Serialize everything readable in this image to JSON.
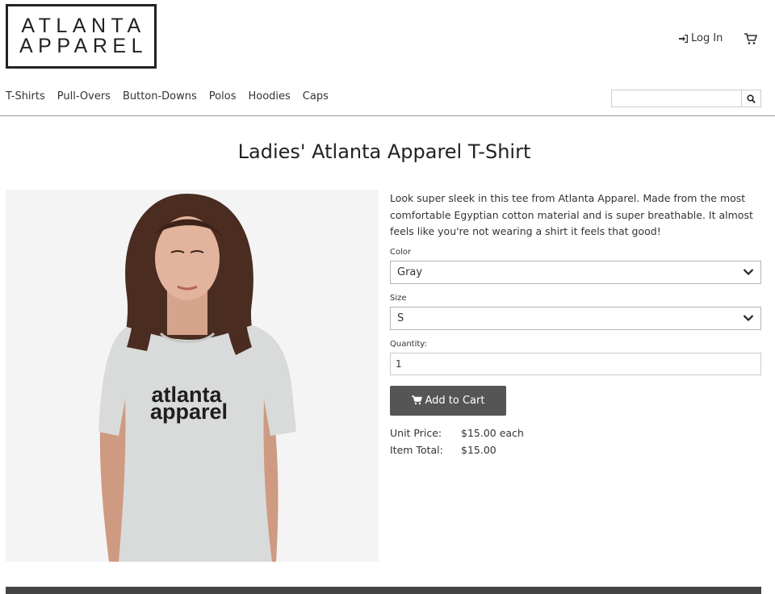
{
  "brand": {
    "line1": "ATLANTA",
    "line2": "APPAREL"
  },
  "header": {
    "login_label": "Log In",
    "cart_icon": "shopping-cart-icon"
  },
  "nav": {
    "items": [
      "T-Shirts",
      "Pull-Overs",
      "Button-Downs",
      "Polos",
      "Hoodies",
      "Caps"
    ]
  },
  "search": {
    "value": "",
    "placeholder": "",
    "icon": "search-icon"
  },
  "product": {
    "title": "Ladies' Atlanta Apparel T-Shirt",
    "shirt_print_line1": "atlanta",
    "shirt_print_line2": "apparel",
    "description": "Look super sleek in this tee from Atlanta Apparel. Made from the most comfortable Egyptian cotton material and is super breathable. It almost feels like you're not wearing a shirt it feels that good!",
    "color_label": "Color",
    "color_value": "Gray",
    "size_label": "Size",
    "size_value": "S",
    "quantity_label": "Quantity:",
    "quantity_value": "1",
    "add_to_cart_label": "Add to Cart",
    "unit_price_label": "Unit Price:",
    "unit_price_value": "$15.00 each",
    "item_total_label": "Item Total:",
    "item_total_value": "$15.00"
  },
  "colors": {
    "button_bg": "#555555",
    "footer_bg": "#444444",
    "shirt": "#d8dbd9"
  }
}
